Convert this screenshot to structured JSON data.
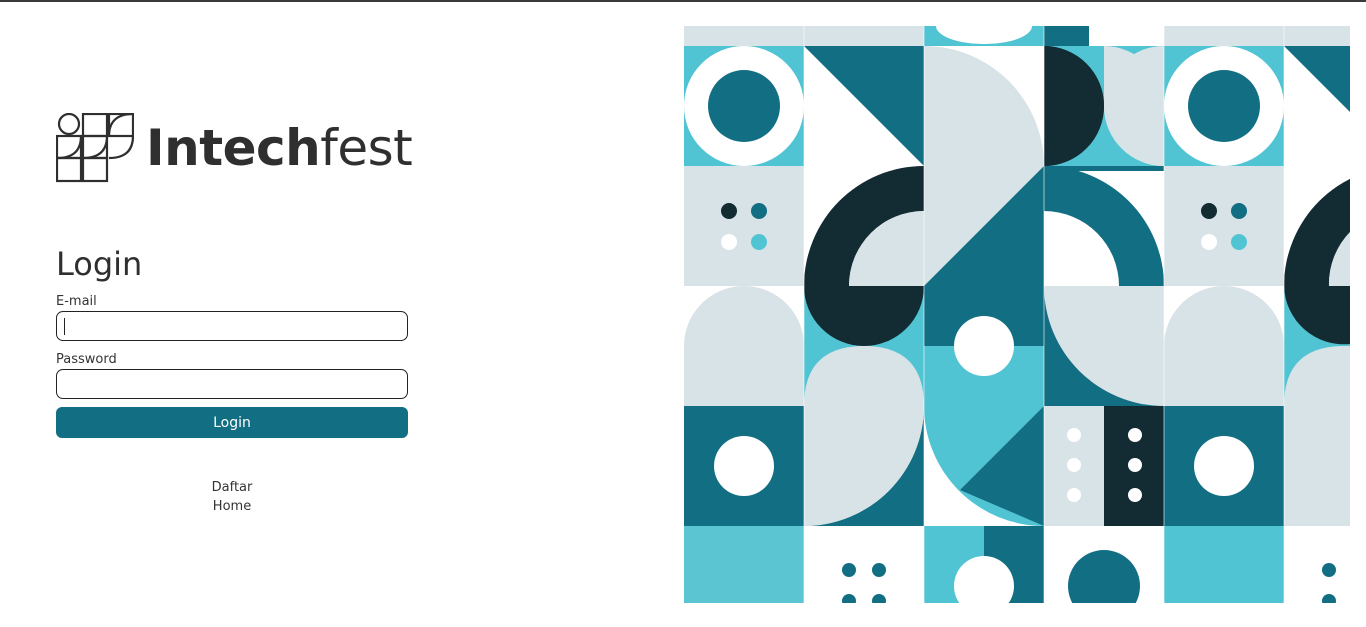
{
  "brand": {
    "name_bold": "Intech",
    "name_light": "fest",
    "logo_icon": "intechfest-logo-icon"
  },
  "login": {
    "title": "Login",
    "email_label": "E-mail",
    "email_value": "",
    "password_label": "Password",
    "password_value": "",
    "submit_label": "Login"
  },
  "links": {
    "register": "Daftar",
    "home": "Home"
  },
  "colors": {
    "accent": "#126e82",
    "teal_light": "#51c4d3",
    "pale": "#d8e3e7",
    "dark": "#132c33"
  }
}
